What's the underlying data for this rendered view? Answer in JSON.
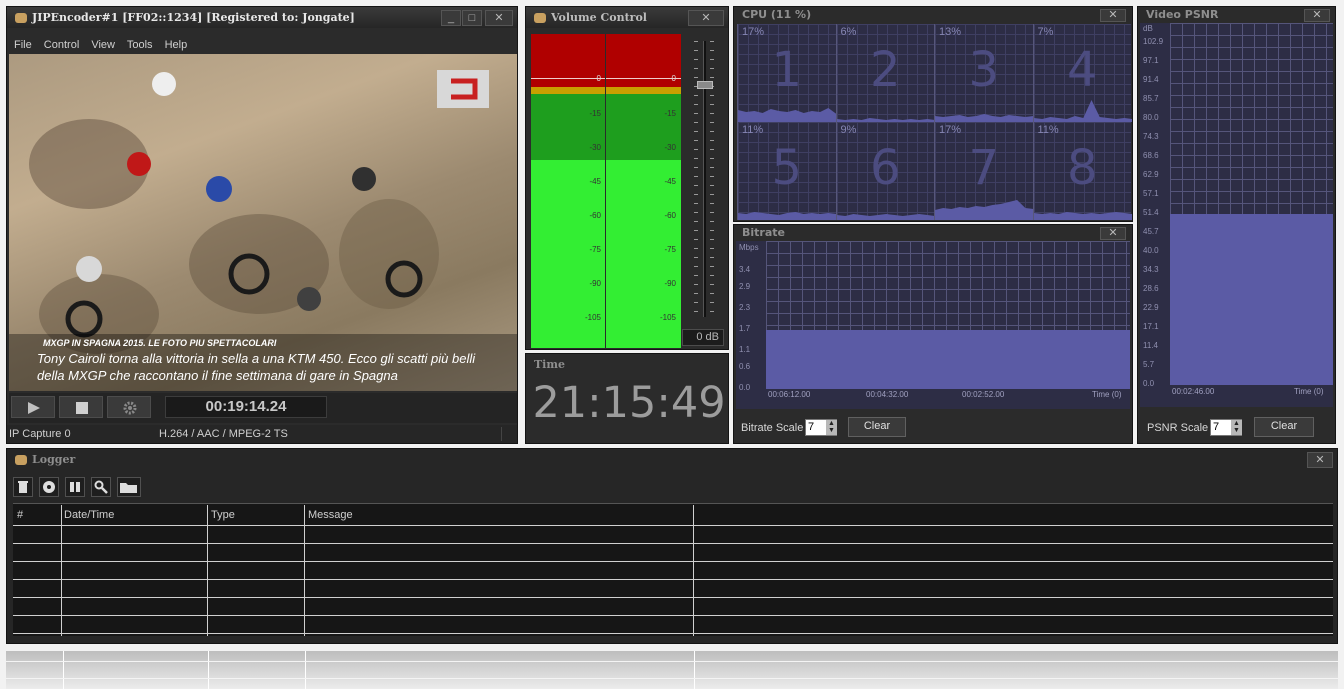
{
  "main_window": {
    "title": "JIPEncoder#1  [FF02::1234] [Registered to: Jongate]",
    "menu": [
      "File",
      "Control",
      "View",
      "Tools",
      "Help"
    ],
    "video": {
      "caption_heading": "MXGP IN SPAGNA 2015. LE FOTO PIU SPETTACOLARI",
      "caption_line1": "Tony Cairoli torna alla vittoria in sella a una KTM 450. Ecco gli scatti più belli",
      "caption_line2": "della MXGP che raccontano il fine settimana di gare in Spagna"
    },
    "elapsed": "00:19:14.24",
    "status_left": "IP Capture 0",
    "status_codec": "H.264 / AAC / MPEG-2 TS"
  },
  "volume": {
    "title": "Volume Control",
    "scale": [
      "0",
      "-15",
      "-30",
      "-45",
      "-60",
      "-75",
      "-90",
      "-105"
    ],
    "gain": "0 dB"
  },
  "time": {
    "title": "Time",
    "value": "21:15:49"
  },
  "cpu": {
    "title": "CPU (11 %)",
    "cores": [
      {
        "num": "1",
        "pct": "17%"
      },
      {
        "num": "2",
        "pct": "6%"
      },
      {
        "num": "3",
        "pct": "13%"
      },
      {
        "num": "4",
        "pct": "7%"
      },
      {
        "num": "5",
        "pct": "11%"
      },
      {
        "num": "6",
        "pct": "9%"
      },
      {
        "num": "7",
        "pct": "17%"
      },
      {
        "num": "8",
        "pct": "11%"
      }
    ]
  },
  "bitrate": {
    "title": "Bitrate",
    "unit": "Mbps",
    "y_ticks": [
      "3.4",
      "2.9",
      "2.3",
      "1.7",
      "1.1",
      "0.6",
      "0.0"
    ],
    "x_ticks": [
      "00:06:12.00",
      "00:04:32.00",
      "00:02:52.00",
      "Time (0)"
    ],
    "level_value": 1.7,
    "scale_label": "Bitrate Scale",
    "scale_value": "7",
    "clear_label": "Clear"
  },
  "psnr": {
    "title": "Video PSNR",
    "unit": "dB",
    "y_ticks": [
      "102.9",
      "97.1",
      "91.4",
      "85.7",
      "80.0",
      "74.3",
      "68.6",
      "62.9",
      "57.1",
      "51.4",
      "45.7",
      "40.0",
      "34.3",
      "28.6",
      "22.9",
      "17.1",
      "11.4",
      "5.7",
      "0.0"
    ],
    "x_ticks": [
      "00:02:46.00",
      "Time (0)"
    ],
    "level_value": 51.4,
    "scale_label": "PSNR Scale",
    "scale_value": "7",
    "clear_label": "Clear"
  },
  "logger": {
    "title": "Logger",
    "columns": [
      "#",
      "Date/Time",
      "Type",
      "Message"
    ],
    "tools": [
      "trash-icon",
      "record-icon",
      "pause-icon",
      "search-icon",
      "folder-icon"
    ]
  },
  "colors": {
    "meter_red": "#b00000",
    "meter_green_dark": "#1e9e1e",
    "meter_green": "#33ee33",
    "chart_fill": "#5b5ba5",
    "chart_bg": "#2d2d45"
  }
}
